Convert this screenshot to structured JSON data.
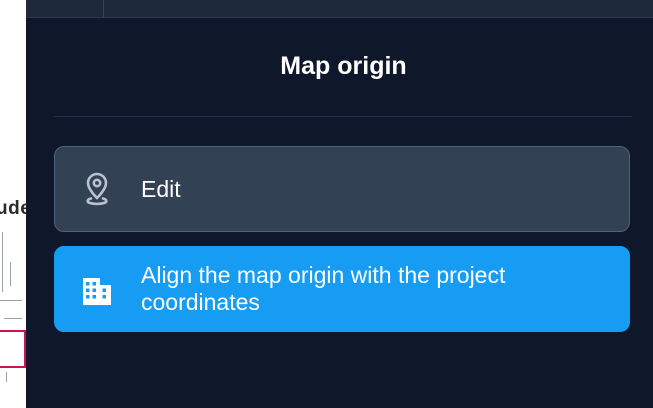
{
  "background": {
    "partial_text": "ude"
  },
  "panel": {
    "title": "Map origin",
    "buttons": [
      {
        "label": "Edit",
        "icon": "map-pin-icon"
      },
      {
        "label": "Align the map origin with the project coordinates",
        "icon": "building-icon"
      }
    ]
  },
  "colors": {
    "panel_bg": "#0f172a",
    "edit_bg": "#334155",
    "align_bg": "#169cf2",
    "text": "#ffffff"
  }
}
